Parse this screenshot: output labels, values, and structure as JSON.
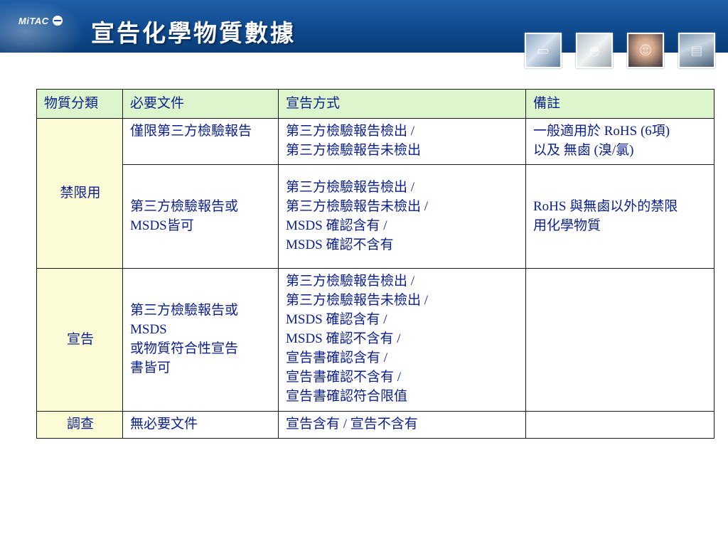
{
  "header": {
    "logo_text": "MiTAC",
    "title": "宣告化學物質數據"
  },
  "table": {
    "headers": [
      "物質分類",
      "必要文件",
      "宣告方式",
      "備註"
    ],
    "rows": {
      "restricted_a": {
        "category": "禁限用",
        "doc": "僅限第三方檢驗報告",
        "method": [
          "第三方檢驗報告檢出 /",
          "第三方檢驗報告未檢出"
        ],
        "note": [
          "一般適用於 RoHS (6項)",
          "以及 無鹵 (溴/氯)"
        ]
      },
      "restricted_b": {
        "doc": [
          "第三方檢驗報告或",
          "MSDS皆可"
        ],
        "method": [
          "第三方檢驗報告檢出 /",
          "第三方檢驗報告未檢出 /",
          "MSDS 確認含有 /",
          "MSDS 確認不含有"
        ],
        "note": [
          "RoHS 與無鹵以外的禁限",
          "用化學物質"
        ]
      },
      "declare": {
        "category": "宣告",
        "doc": [
          "第三方檢驗報告或",
          "MSDS",
          "或物質符合性宣告",
          "書皆可"
        ],
        "method": [
          "第三方檢驗報告檢出 /",
          "第三方檢驗報告未檢出 /",
          "MSDS 確認含有 /",
          "MSDS 確認不含有 /",
          "宣告書確認含有 /",
          "宣告書確認不含有 /",
          "宣告書確認符合限值"
        ],
        "note": ""
      },
      "survey": {
        "category": "調查",
        "doc": "無必要文件",
        "method": "宣告含有 / 宣告不含有",
        "note": ""
      }
    }
  },
  "colors": {
    "header_bg": "#0f4a8e",
    "table_header_bg": "#ddf5cc",
    "category_bg": "#fbfbd6",
    "text": "#0b1f8c"
  },
  "icons": [
    "computer-photo-icon",
    "product-photo-icon",
    "person-photo-icon",
    "device-photo-icon"
  ]
}
